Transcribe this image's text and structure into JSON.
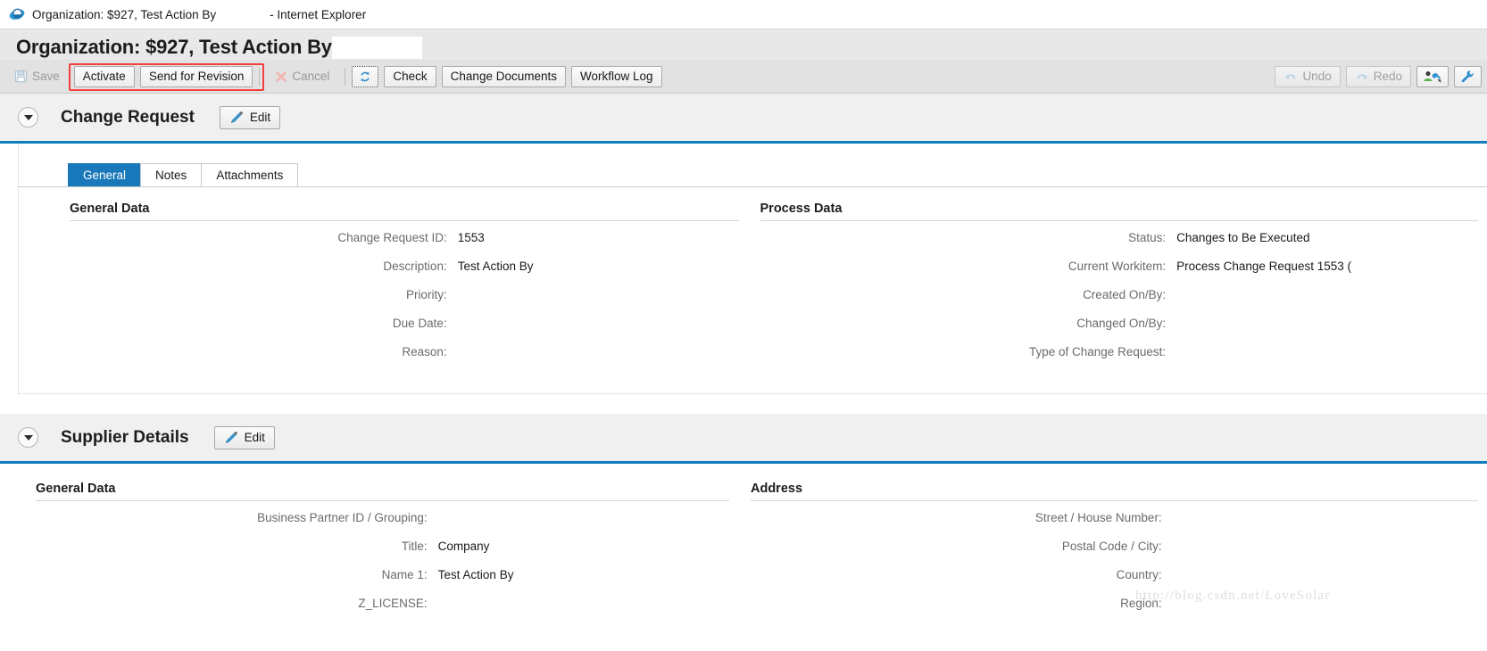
{
  "window": {
    "title": "Organization: $927, Test Action By",
    "app_suffix": "- Internet Explorer",
    "browser_icon": "internet-explorer-icon"
  },
  "header": {
    "page_title": "Organization: $927, Test Action By",
    "redacted_field_value": ""
  },
  "toolbar": {
    "highlight_color": "#f53f3f",
    "left_buttons": [
      {
        "label": "Save",
        "icon": "save-icon",
        "state": "disabled"
      },
      {
        "label": "Activate",
        "icon": "",
        "state": "enabled"
      },
      {
        "label": "Send for Revision",
        "icon": "",
        "state": "enabled"
      },
      {
        "label": "Cancel",
        "icon": "cancel-icon",
        "state": "disabled"
      },
      {
        "label": "",
        "icon": "refresh-icon",
        "state": "focused"
      },
      {
        "label": "Check",
        "icon": "",
        "state": "enabled"
      },
      {
        "label": "Change Documents",
        "icon": "",
        "state": "enabled"
      },
      {
        "label": "Workflow Log",
        "icon": "",
        "state": "enabled"
      }
    ],
    "right_buttons": [
      {
        "label": "Undo",
        "icon": "undo-icon",
        "state": "disabled"
      },
      {
        "label": "Redo",
        "icon": "redo-icon",
        "state": "disabled"
      },
      {
        "label": "",
        "icon": "personalize-icon",
        "state": "enabled"
      },
      {
        "label": "",
        "icon": "settings-wrench-icon",
        "state": "enabled"
      }
    ]
  },
  "sections": [
    {
      "title": "Change Request",
      "edit_label": "Edit",
      "collapse_icon": "chevron-down-icon",
      "edit_icon": "pencil-icon",
      "tabs": [
        {
          "label": "General",
          "active": true
        },
        {
          "label": "Notes",
          "active": false
        },
        {
          "label": "Attachments",
          "active": false
        }
      ],
      "left_group": {
        "title": "General Data",
        "rows": [
          {
            "label": "Change Request ID:",
            "value": "1553"
          },
          {
            "label": "Description:",
            "value": "Test Action By"
          },
          {
            "label": "Priority:",
            "value": ""
          },
          {
            "label": "Due Date:",
            "value": ""
          },
          {
            "label": "Reason:",
            "value": ""
          }
        ]
      },
      "right_group": {
        "title": "Process Data",
        "rows": [
          {
            "label": "Status:",
            "value": "Changes to Be Executed"
          },
          {
            "label": "Current Workitem:",
            "value": "Process Change Request 1553 ("
          },
          {
            "label": "Created On/By:",
            "value": ""
          },
          {
            "label": "Changed On/By:",
            "value": ""
          },
          {
            "label": "Type of Change Request:",
            "value": ""
          }
        ]
      }
    },
    {
      "title": "Supplier Details",
      "edit_label": "Edit",
      "collapse_icon": "chevron-down-icon",
      "edit_icon": "pencil-icon",
      "left_group": {
        "title": "General Data",
        "rows": [
          {
            "label": "Business Partner ID / Grouping:",
            "value": ""
          },
          {
            "label": "Title:",
            "value": "Company"
          },
          {
            "label": "Name 1:",
            "value": "Test Action By"
          },
          {
            "label": "Z_LICENSE:",
            "value": ""
          }
        ]
      },
      "right_group": {
        "title": "Address",
        "rows": [
          {
            "label": "Street / House Number:",
            "value": ""
          },
          {
            "label": "Postal Code / City:",
            "value": ""
          },
          {
            "label": "Country:",
            "value": ""
          },
          {
            "label": "Region:",
            "value": ""
          }
        ]
      }
    }
  ],
  "watermark": {
    "text": "http://blog.csdn.net/LoveSolar"
  }
}
